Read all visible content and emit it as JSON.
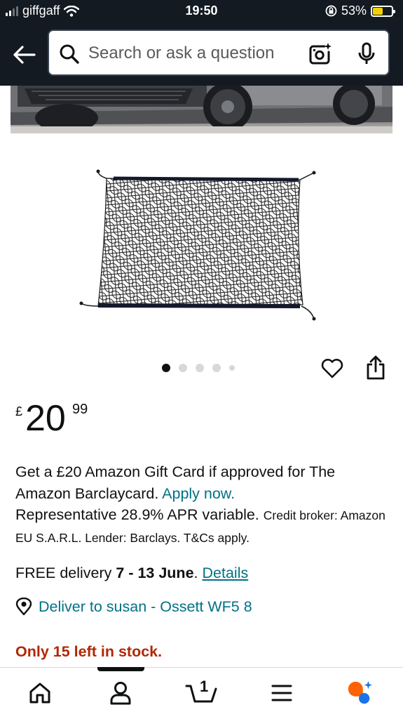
{
  "status_bar": {
    "carrier": "giffgaff",
    "time": "19:50",
    "battery_percent": "53%",
    "battery_level": 0.53
  },
  "search": {
    "placeholder": "Search or ask a question"
  },
  "gallery": {
    "image_count": 5,
    "active_index": 0
  },
  "price": {
    "currency": "£",
    "whole": "20",
    "fraction": "99"
  },
  "offer": {
    "line1": "Get a £20 Amazon Gift Card if approved for The Amazon Barclaycard.",
    "apply_link": "Apply now.",
    "apr": "Representative 28.9% APR variable.",
    "broker": "Credit broker: Amazon EU S.A.R.L. Lender: Barclays. T&Cs apply."
  },
  "delivery": {
    "prefix": "FREE delivery",
    "dates": "7 - 13 June",
    "suffix": ".",
    "details_link": "Details"
  },
  "deliver_to": "Deliver to susan - Ossett WF5 8",
  "stock": "Only 15 left in stock.",
  "bottom_nav": {
    "cart_count": "1"
  },
  "colors": {
    "header_bg": "#131a22",
    "link": "#007185",
    "stock": "#b12704",
    "accent": "#ff6200",
    "rufus_blue": "#1a73e8"
  },
  "icons": [
    "back-arrow-icon",
    "search-icon",
    "camera-icon",
    "mic-icon",
    "heart-icon",
    "share-icon",
    "location-pin-icon",
    "home-icon",
    "account-icon",
    "cart-icon",
    "menu-icon",
    "rufus-icon"
  ]
}
